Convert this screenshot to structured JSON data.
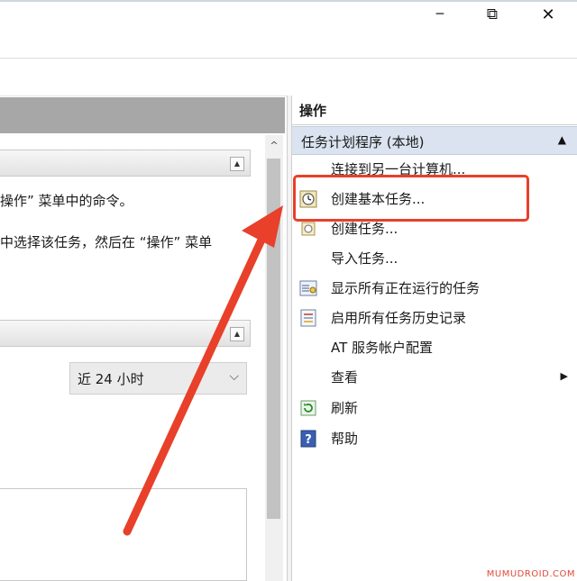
{
  "window": {
    "minimize_glyph": "─",
    "restore_glyph": "⧉",
    "close_glyph": "✕"
  },
  "middle": {
    "line1": "操作” 菜单中的命令。",
    "line2": "中选择该任务，然后在 “操作” 菜单",
    "dropdown_value": "近 24 小时"
  },
  "actions_panel": {
    "title": "操作",
    "group_label": "任务计划程序 (本地)",
    "items": [
      {
        "label": "连接到另一台计算机...",
        "icon": "none"
      },
      {
        "label": "创建基本任务...",
        "icon": "clock-task-icon"
      },
      {
        "label": "创建任务...",
        "icon": "task-icon"
      },
      {
        "label": "导入任务...",
        "icon": "none"
      },
      {
        "label": "显示所有正在运行的任务",
        "icon": "running-tasks-icon"
      },
      {
        "label": "启用所有任务历史记录",
        "icon": "history-icon"
      },
      {
        "label": "AT 服务帐户配置",
        "icon": "none"
      },
      {
        "label": "查看",
        "icon": "none"
      },
      {
        "label": "刷新",
        "icon": "refresh-icon"
      },
      {
        "label": "帮助",
        "icon": "help-icon"
      }
    ]
  },
  "colors": {
    "annotation": "#e8402a",
    "group_header": "#dae3ef",
    "panel_header": "#a7a7a7"
  },
  "watermark": "MUMUDROID.COM"
}
